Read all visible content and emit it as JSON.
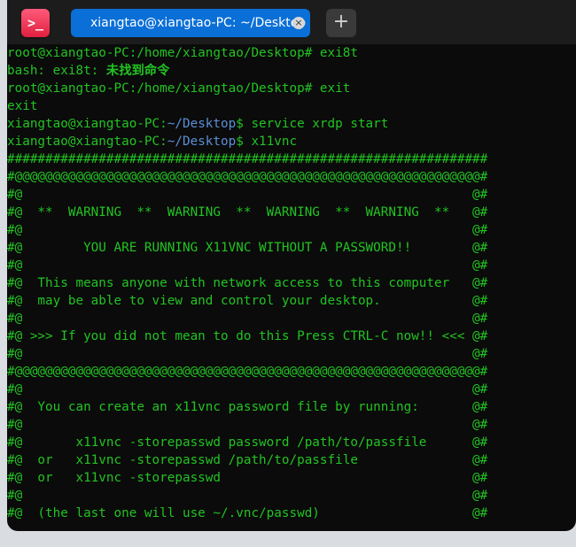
{
  "titlebar": {
    "app_icon": ">_",
    "tab_title": "xiangtao@xiangtao-PC: ~/Desktop",
    "tab_close": "×",
    "new_tab": "+"
  },
  "terminal": {
    "lines": [
      {
        "segments": [
          {
            "text": "root@xiangtao-PC:/home/xiangtao/Desktop# exi8t",
            "cls": "green"
          }
        ]
      },
      {
        "segments": [
          {
            "text": "bash: exi8t: ",
            "cls": "green"
          },
          {
            "text": "未找到命令",
            "cls": "cn"
          }
        ]
      },
      {
        "segments": [
          {
            "text": "root@xiangtao-PC:/home/xiangtao/Desktop# exit",
            "cls": "green"
          }
        ]
      },
      {
        "segments": [
          {
            "text": "exit",
            "cls": "green"
          }
        ]
      },
      {
        "segments": [
          {
            "text": "xiangtao@xiangtao-PC:",
            "cls": "green"
          },
          {
            "text": "~/Desktop",
            "cls": "blue"
          },
          {
            "text": "$ service xrdp start",
            "cls": "green"
          }
        ]
      },
      {
        "segments": [
          {
            "text": "xiangtao@xiangtao-PC:",
            "cls": "green"
          },
          {
            "text": "~/Desktop",
            "cls": "blue"
          },
          {
            "text": "$ x11vnc",
            "cls": "green"
          }
        ]
      },
      {
        "segments": [
          {
            "text": "###############################################################",
            "cls": "green"
          }
        ]
      },
      {
        "segments": [
          {
            "text": "#@@@@@@@@@@@@@@@@@@@@@@@@@@@@@@@@@@@@@@@@@@@@@@@@@@@@@@@@@@@@@#",
            "cls": "green"
          }
        ]
      },
      {
        "segments": [
          {
            "text": "#@                                                           @#",
            "cls": "green"
          }
        ]
      },
      {
        "segments": [
          {
            "text": "#@  **  WARNING  **  WARNING  **  WARNING  **  WARNING  **   @#",
            "cls": "green"
          }
        ]
      },
      {
        "segments": [
          {
            "text": "#@                                                           @#",
            "cls": "green"
          }
        ]
      },
      {
        "segments": [
          {
            "text": "#@        YOU ARE RUNNING X11VNC WITHOUT A PASSWORD!!        @#",
            "cls": "green"
          }
        ]
      },
      {
        "segments": [
          {
            "text": "#@                                                           @#",
            "cls": "green"
          }
        ]
      },
      {
        "segments": [
          {
            "text": "#@  This means anyone with network access to this computer   @#",
            "cls": "green"
          }
        ]
      },
      {
        "segments": [
          {
            "text": "#@  may be able to view and control your desktop.            @#",
            "cls": "green"
          }
        ]
      },
      {
        "segments": [
          {
            "text": "#@                                                           @#",
            "cls": "green"
          }
        ]
      },
      {
        "segments": [
          {
            "text": "#@ >>> If you did not mean to do this Press CTRL-C now!! <<< @#",
            "cls": "green"
          }
        ]
      },
      {
        "segments": [
          {
            "text": "#@                                                           @#",
            "cls": "green"
          }
        ]
      },
      {
        "segments": [
          {
            "text": "#@@@@@@@@@@@@@@@@@@@@@@@@@@@@@@@@@@@@@@@@@@@@@@@@@@@@@@@@@@@@@#",
            "cls": "green"
          }
        ]
      },
      {
        "segments": [
          {
            "text": "#@                                                           @#",
            "cls": "green"
          }
        ]
      },
      {
        "segments": [
          {
            "text": "#@  You can create an x11vnc password file by running:       @#",
            "cls": "green"
          }
        ]
      },
      {
        "segments": [
          {
            "text": "#@                                                           @#",
            "cls": "green"
          }
        ]
      },
      {
        "segments": [
          {
            "text": "#@       x11vnc -storepasswd password /path/to/passfile      @#",
            "cls": "green"
          }
        ]
      },
      {
        "segments": [
          {
            "text": "#@  or   x11vnc -storepasswd /path/to/passfile               @#",
            "cls": "green"
          }
        ]
      },
      {
        "segments": [
          {
            "text": "#@  or   x11vnc -storepasswd                                 @#",
            "cls": "green"
          }
        ]
      },
      {
        "segments": [
          {
            "text": "#@                                                           @#",
            "cls": "green"
          }
        ]
      },
      {
        "segments": [
          {
            "text": "#@  (the last one will use ~/.vnc/passwd)                    @#",
            "cls": "green"
          }
        ]
      }
    ]
  }
}
